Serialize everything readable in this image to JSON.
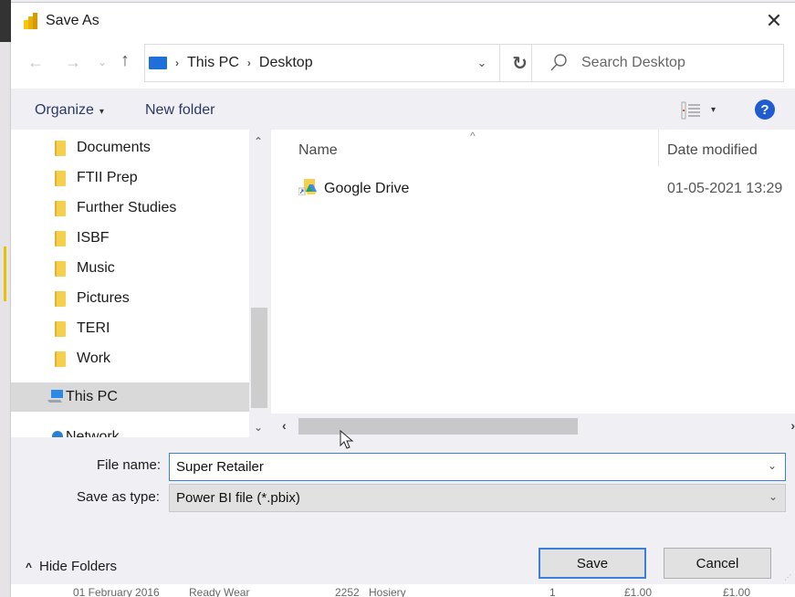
{
  "window": {
    "title": "Save As",
    "close_glyph": "✕"
  },
  "navigation": {
    "back_glyph": "←",
    "forward_glyph": "→",
    "recent_glyph": "⌄",
    "up_glyph": "↑",
    "breadcrumb": [
      "This PC",
      "Desktop"
    ],
    "breadcrumb_sep": "›",
    "dropdown_glyph": "⌄",
    "refresh_glyph": "↻",
    "search_placeholder": "Search Desktop"
  },
  "toolbar": {
    "organize_label": "Organize",
    "organize_caret": "▾",
    "new_folder_label": "New folder",
    "view_caret": "▾",
    "help_glyph": "?"
  },
  "nav_pane": {
    "folders": [
      "Documents",
      "FTII Prep",
      "Further Studies",
      "ISBF",
      "Music",
      "Pictures",
      "TERI",
      "Work"
    ],
    "this_pc_label": "This PC",
    "network_label": "Network",
    "scroll_up_glyph": "⌃",
    "scroll_down_glyph": "⌄"
  },
  "file_list": {
    "columns": [
      "Name",
      "Date modified"
    ],
    "sort_glyph": "^",
    "rows": [
      {
        "name": "Google Drive",
        "date_modified": "01-05-2021 13:29"
      }
    ],
    "scroll_left_glyph": "‹",
    "scroll_right_glyph": "›"
  },
  "form": {
    "file_name_label": "File name:",
    "file_name_value": "Super Retailer",
    "save_as_type_label": "Save as type:",
    "save_as_type_value": "Power BI file (*.pbix)",
    "dropdown_glyph": "⌄"
  },
  "footer": {
    "hide_folders_label": "Hide Folders",
    "hide_folders_glyph": "^",
    "save_label": "Save",
    "cancel_label": "Cancel"
  },
  "background_row": [
    "01 February 2016",
    "Ready Wear",
    "2252",
    "Hosiery",
    "1",
    "£1.00",
    "£1.00"
  ],
  "colors": {
    "accent": "#1f5bd1",
    "folder": "#f5cf4e",
    "selection": "#d9d9d9",
    "powerbi": "#f2c811"
  }
}
